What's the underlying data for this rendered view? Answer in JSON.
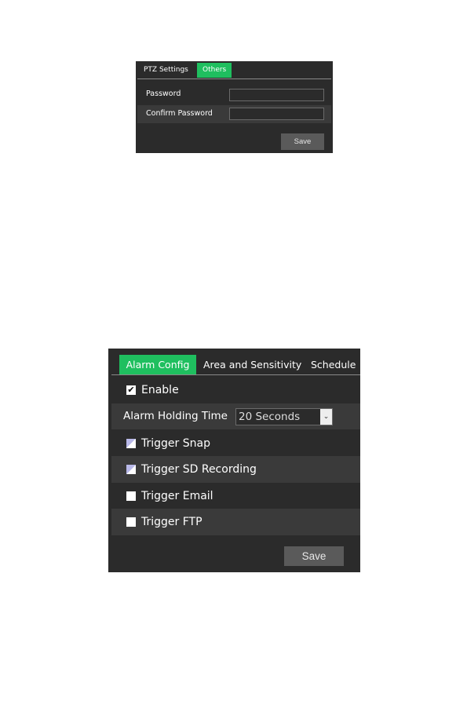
{
  "ptz_panel": {
    "tabs": [
      {
        "label": "PTZ Settings",
        "active": false
      },
      {
        "label": "Others",
        "active": true
      }
    ],
    "password_label": "Password",
    "password_value": "",
    "confirm_label": "Confirm Password",
    "confirm_value": "",
    "save_label": "Save"
  },
  "alarm_panel": {
    "tabs": [
      {
        "label": "Alarm Config",
        "active": true
      },
      {
        "label": "Area and Sensitivity",
        "active": false
      },
      {
        "label": "Schedule",
        "active": false
      }
    ],
    "enable": {
      "label": "Enable",
      "checked": true
    },
    "holding_time": {
      "label": "Alarm Holding Time",
      "value": "20 Seconds"
    },
    "triggers": [
      {
        "label": "Trigger Snap",
        "checked": false
      },
      {
        "label": "Trigger SD Recording",
        "checked": false
      },
      {
        "label": "Trigger Email",
        "checked": false
      },
      {
        "label": "Trigger FTP",
        "checked": false
      }
    ],
    "save_label": "Save"
  },
  "colors": {
    "accent": "#1fbf5f",
    "panel": "#2b2b2b",
    "row_alt": "#3a3a3a"
  }
}
